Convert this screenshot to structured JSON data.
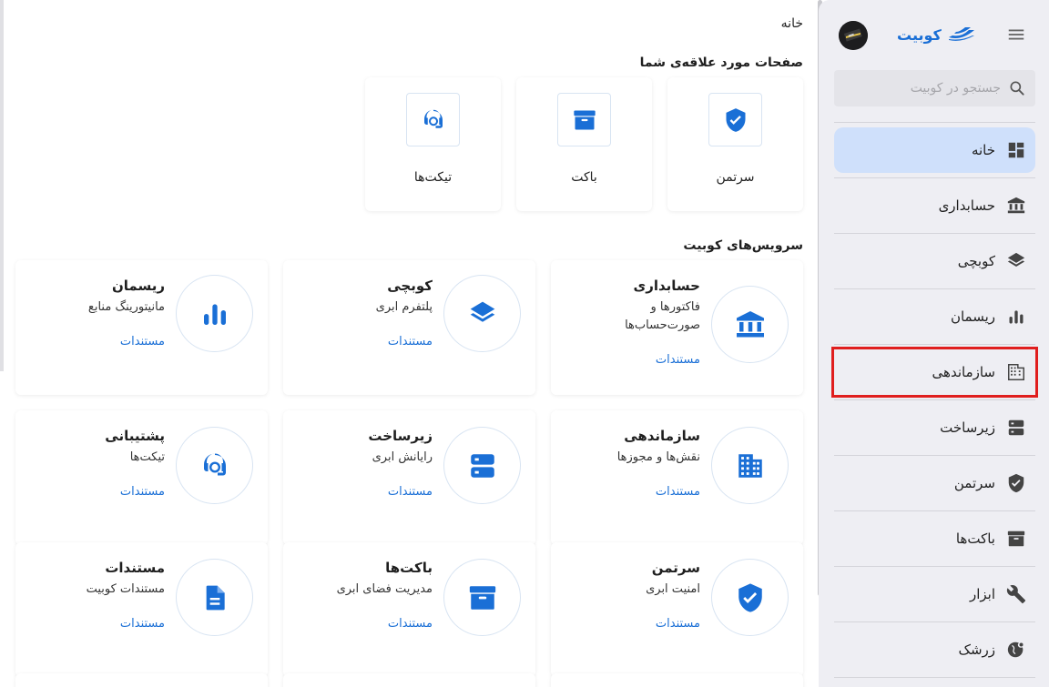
{
  "header": {
    "brand_name": "کوبیت",
    "search_placeholder": "جستجو در کوبیت"
  },
  "sidebar": {
    "items": [
      {
        "label": "خانه"
      },
      {
        "label": "حسابداری"
      },
      {
        "label": "کوبچی"
      },
      {
        "label": "ریسمان"
      },
      {
        "label": "سازماندهی"
      },
      {
        "label": "زیرساخت"
      },
      {
        "label": "سرتمن"
      },
      {
        "label": "باکت‌ها"
      },
      {
        "label": "ابزار"
      },
      {
        "label": "زرشک"
      }
    ]
  },
  "main": {
    "breadcrumb": "خانه",
    "favorites_title": "صفحات مورد علاقه‌ی شما",
    "favorites": [
      {
        "label": "سرتمن",
        "icon": "shield-check-icon"
      },
      {
        "label": "باکت",
        "icon": "archive-box-icon"
      },
      {
        "label": "تیکت‌ها",
        "icon": "headset-icon"
      }
    ],
    "services_title": "سرویس‌های کوبیت",
    "services": [
      {
        "title": "حسابداری",
        "desc_1": "فاکتورها و",
        "desc_2": "صورت‌حساب‌ها",
        "link": "مستندات"
      },
      {
        "title": "کوبچی",
        "desc_1": "پلتفرم ابری",
        "link": "مستندات"
      },
      {
        "title": "ریسمان",
        "desc_1": "مانیتورینگ منابع",
        "link": "مستندات"
      },
      {
        "title": "سازماندهی",
        "desc_1": "نقش‌ها و مجوزها",
        "link": "مستندات"
      },
      {
        "title": "زیرساخت",
        "desc_1": "رایانش ابری",
        "link": "مستندات"
      },
      {
        "title": "پشتیبانی",
        "desc_1": "تیکت‌ها",
        "link": "مستندات"
      },
      {
        "title": "سرتمن",
        "desc_1": "امنیت ابری",
        "link": "مستندات"
      },
      {
        "title": "باکت‌ها",
        "desc_1": "مدیریت فضای ابری",
        "link": "مستندات"
      },
      {
        "title": "مستندات",
        "desc_1": "مستندات کوبیت",
        "link": "مستندات"
      }
    ]
  },
  "colors": {
    "accent": "#1a6fd6",
    "active_nav_bg": "#cfe0fb",
    "sidebar_bg": "#eeeef3",
    "highlight_border": "#e01e1e"
  }
}
